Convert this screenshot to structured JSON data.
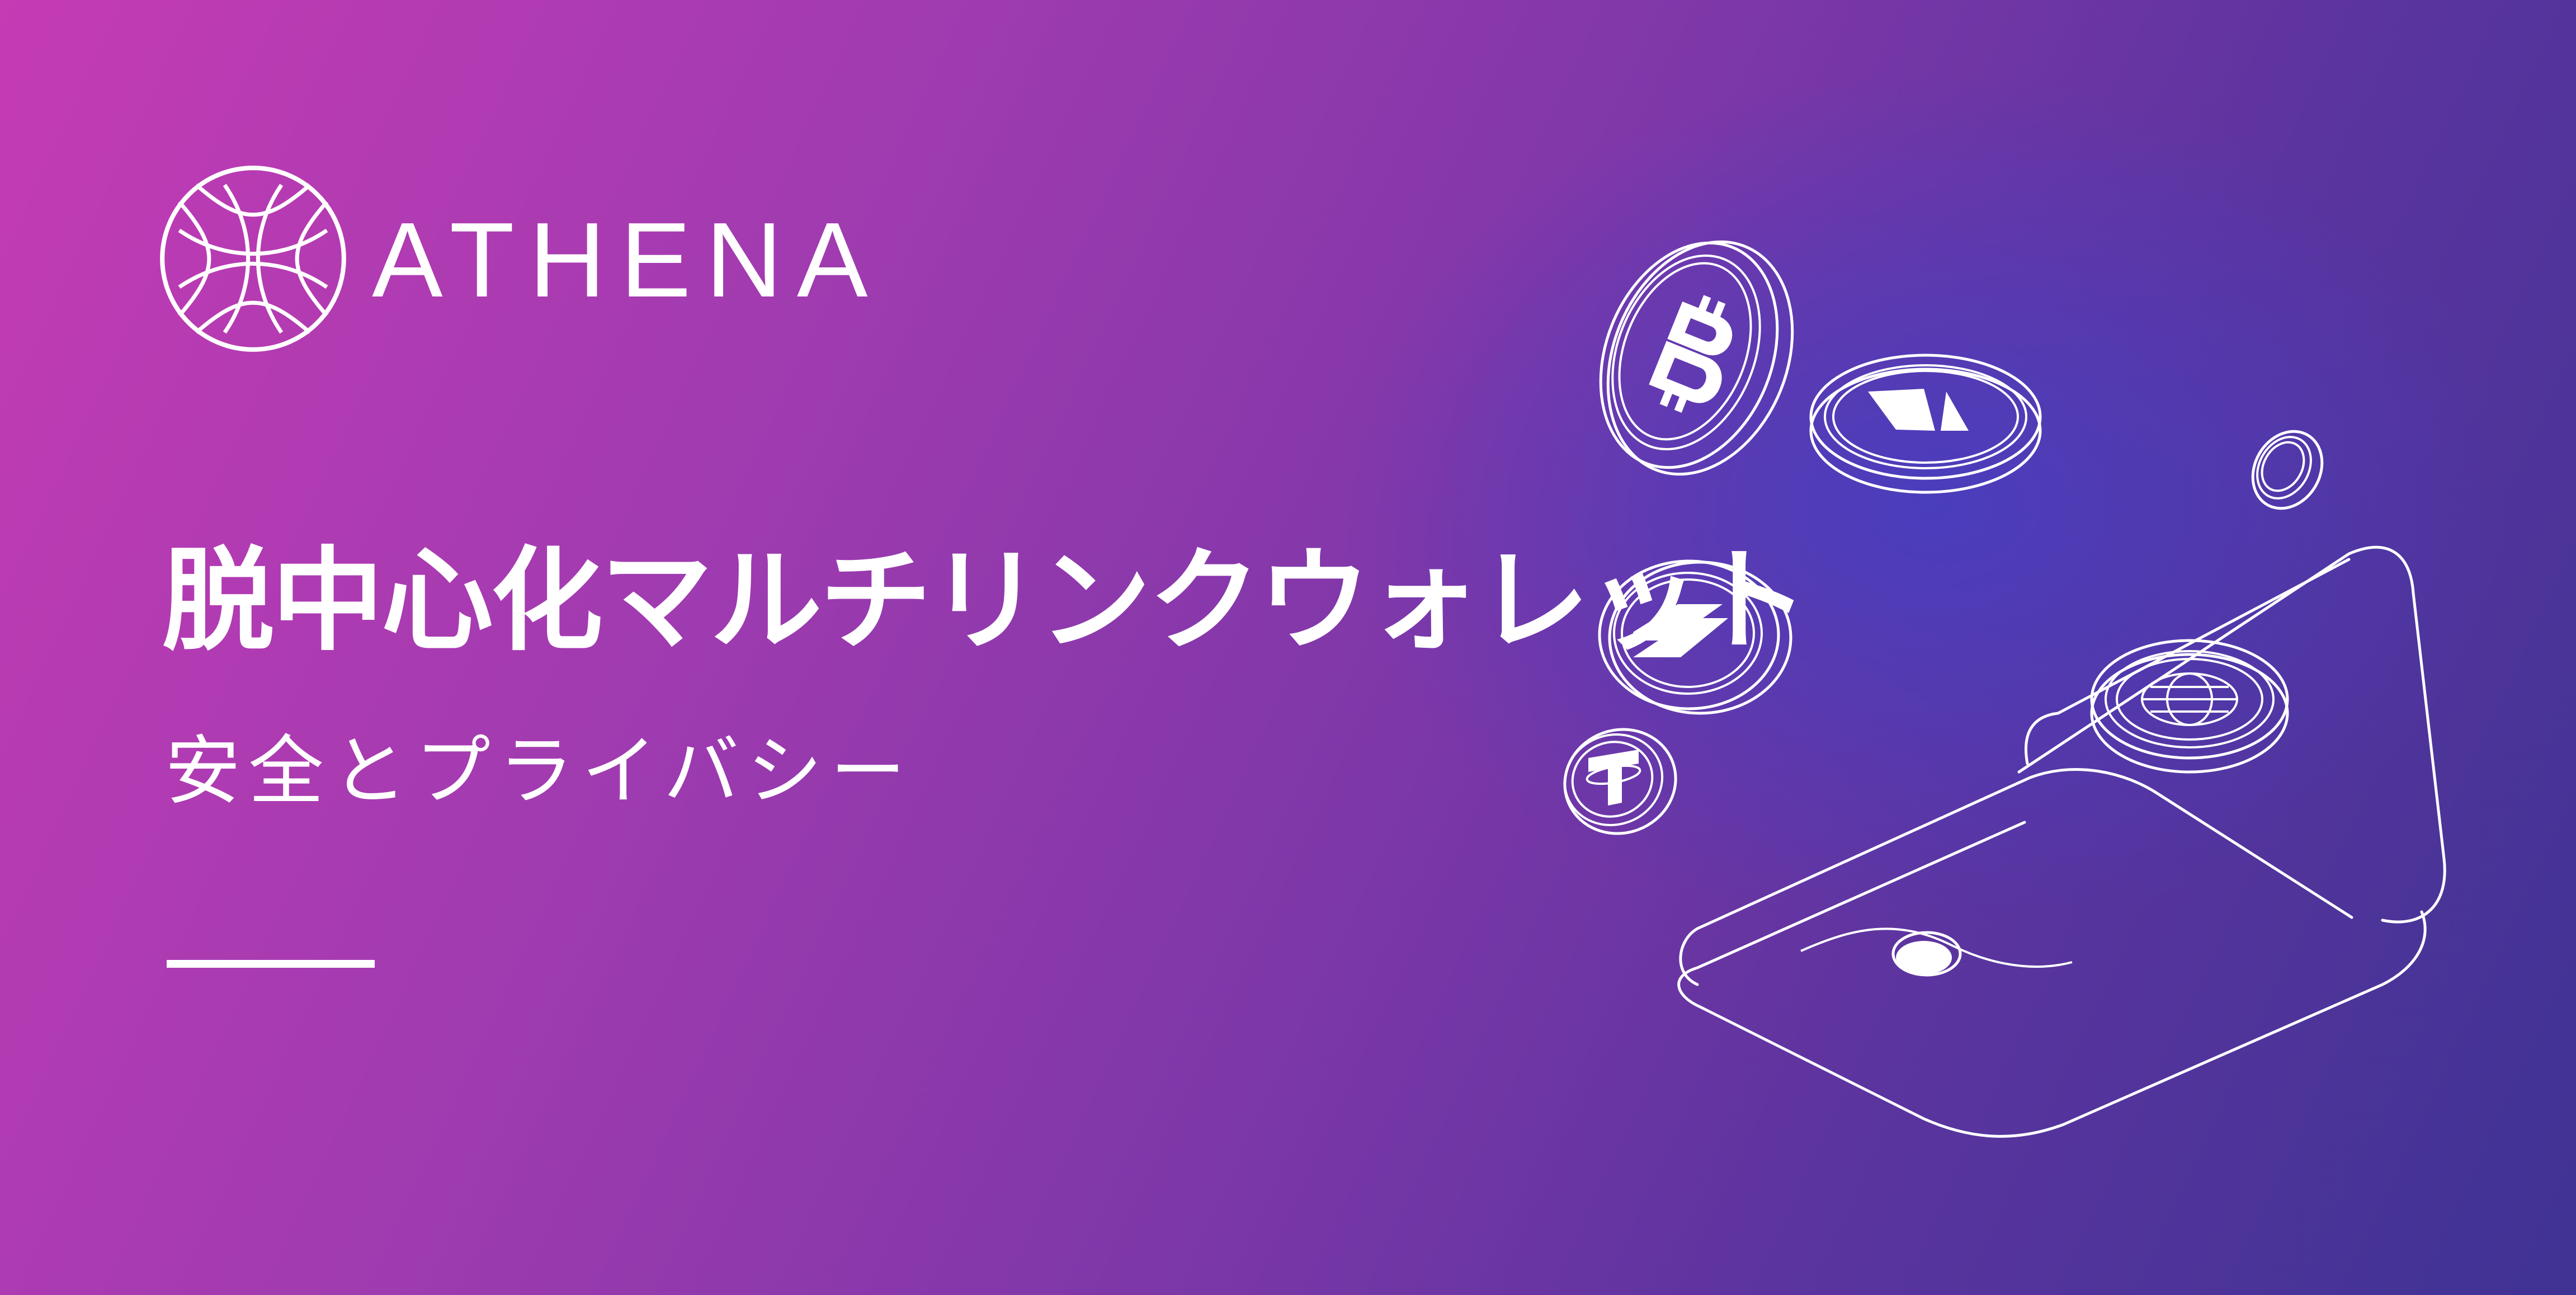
{
  "brand": {
    "name": "ATHENA",
    "logo_icon": "athena-interlaced-circle-logo"
  },
  "headline": "脱中心化マルチリンクウォレット",
  "subheadline": "安全とプライバシー",
  "illustration": {
    "items": [
      "bitcoin-coin-icon",
      "ethereum-coin-icon",
      "bolt-coin-icon",
      "tether-coin-icon",
      "small-coin-icon",
      "globe-coin-icon",
      "wallet-icon"
    ]
  },
  "colors": {
    "gradient_start": "#c43bb4",
    "gradient_mid": "#7d37a8",
    "gradient_end": "#3f3394",
    "glow": "#483ebe",
    "foreground": "#ffffff"
  }
}
